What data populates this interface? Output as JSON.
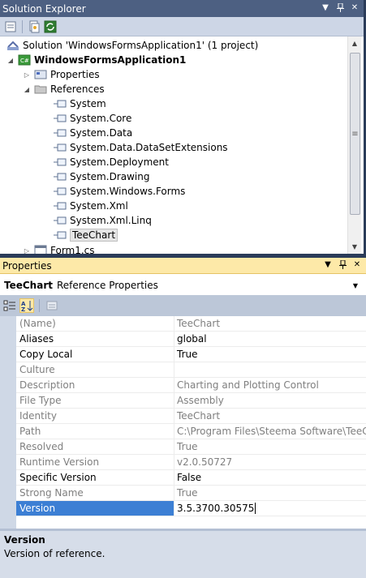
{
  "solution_explorer": {
    "title": "Solution Explorer",
    "tree": {
      "solution": "Solution 'WindowsFormsApplication1' (1 project)",
      "project": "WindowsFormsApplication1",
      "properties": "Properties",
      "references": "References",
      "reference_items": [
        "System",
        "System.Core",
        "System.Data",
        "System.Data.DataSetExtensions",
        "System.Deployment",
        "System.Drawing",
        "System.Windows.Forms",
        "System.Xml",
        "System.Xml.Linq",
        "TeeChart"
      ],
      "form": "Form1.cs"
    },
    "selected_item": "TeeChart"
  },
  "properties": {
    "title": "Properties",
    "object_name": "TeeChart",
    "object_type": "Reference Properties",
    "rows": [
      {
        "name": "(Name)",
        "value": "TeeChart",
        "readonly": true
      },
      {
        "name": "Aliases",
        "value": "global",
        "readonly": false
      },
      {
        "name": "Copy Local",
        "value": "True",
        "readonly": false
      },
      {
        "name": "Culture",
        "value": "",
        "readonly": true
      },
      {
        "name": "Description",
        "value": "Charting and Plotting Control",
        "readonly": true
      },
      {
        "name": "File Type",
        "value": "Assembly",
        "readonly": true
      },
      {
        "name": "Identity",
        "value": "TeeChart",
        "readonly": true
      },
      {
        "name": "Path",
        "value": "C:\\Program Files\\Steema Software\\TeeChar",
        "readonly": true
      },
      {
        "name": "Resolved",
        "value": "True",
        "readonly": true
      },
      {
        "name": "Runtime Version",
        "value": "v2.0.50727",
        "readonly": true
      },
      {
        "name": "Specific Version",
        "value": "False",
        "readonly": false
      },
      {
        "name": "Strong Name",
        "value": "True",
        "readonly": true
      },
      {
        "name": "Version",
        "value": "3.5.3700.30575",
        "readonly": false
      }
    ],
    "selected_row": "Version",
    "description": {
      "title": "Version",
      "text": "Version of reference."
    }
  },
  "icons": {
    "pin": "pin-icon",
    "close": "close-icon",
    "dropdown": "dropdown-arrow-icon",
    "reference": "reference-icon"
  },
  "colors": {
    "se_titlebar": "#4d6082",
    "props_titlebar": "#fde9a8",
    "selection": "#3c7fd4",
    "readonly_text": "#7f7f7f"
  }
}
